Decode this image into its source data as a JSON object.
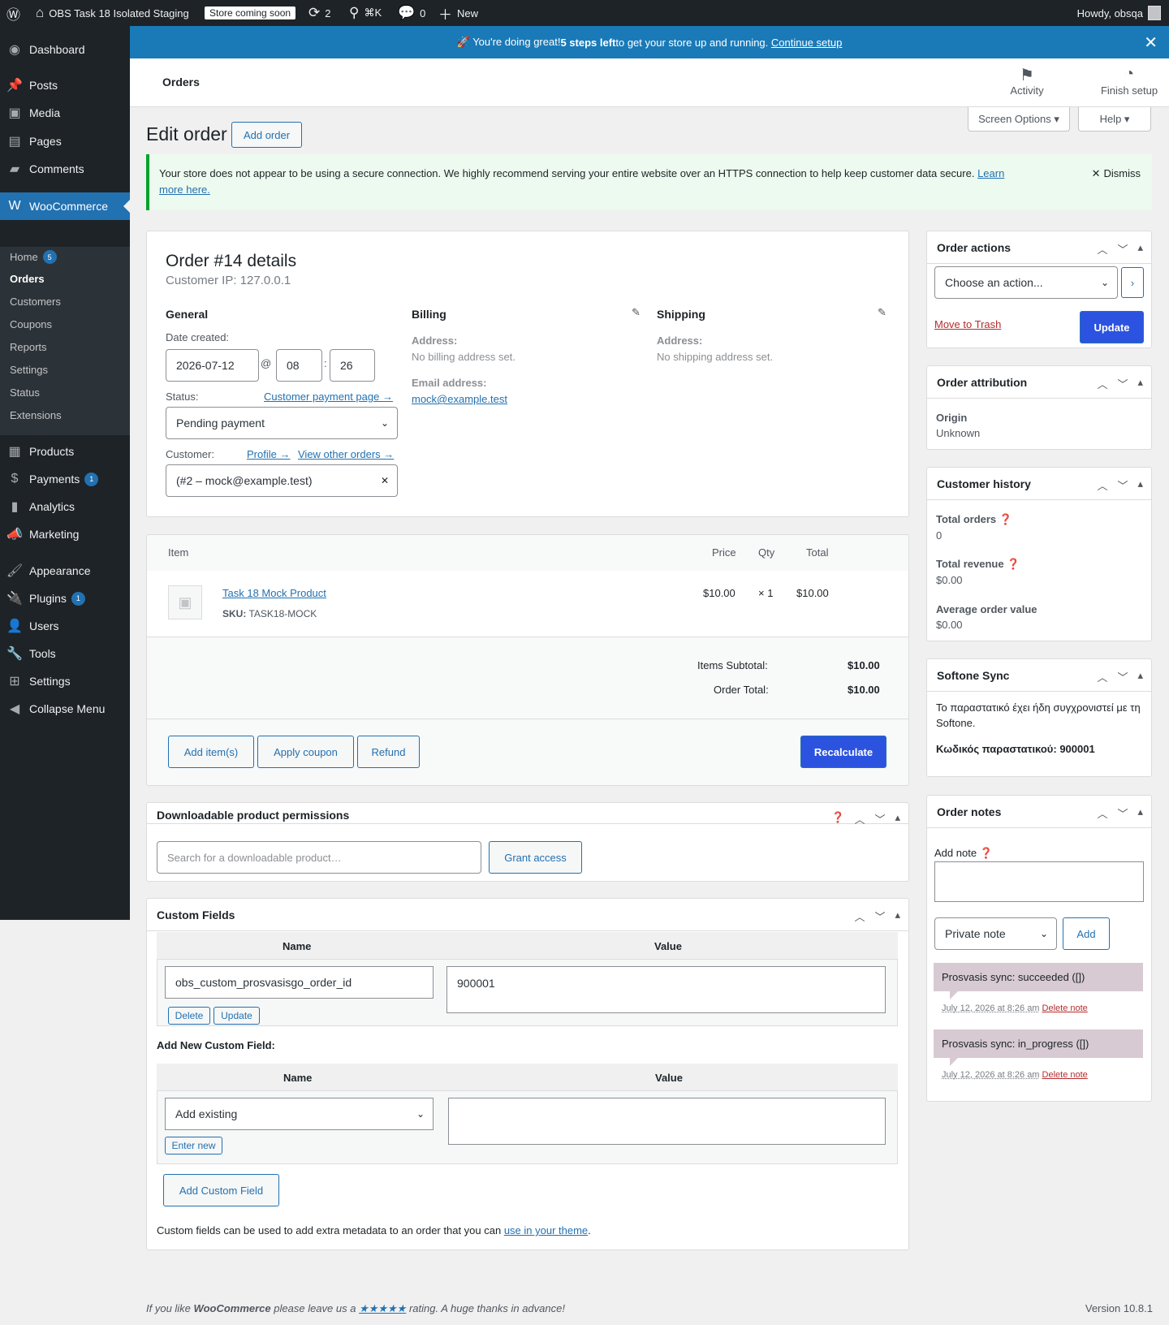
{
  "adminbar": {
    "site": "OBS Task 18 Isolated Staging",
    "store_badge": "Store coming soon",
    "updates": "2",
    "search_shortcut": "⌘K",
    "comments": "0",
    "new": "New",
    "howdy": "Howdy, obsqa"
  },
  "sidebar": {
    "dashboard": "Dashboard",
    "posts": "Posts",
    "media": "Media",
    "pages": "Pages",
    "comments": "Comments",
    "woocommerce": "WooCommerce",
    "sub": {
      "home": "Home",
      "home_count": "5",
      "orders": "Orders",
      "customers": "Customers",
      "coupons": "Coupons",
      "reports": "Reports",
      "settings": "Settings",
      "status": "Status",
      "extensions": "Extensions"
    },
    "products": "Products",
    "payments": "Payments",
    "payments_count": "1",
    "analytics": "Analytics",
    "marketing": "Marketing",
    "appearance": "Appearance",
    "plugins": "Plugins",
    "plugins_count": "1",
    "users": "Users",
    "tools": "Tools",
    "settings": "Settings",
    "collapse": "Collapse Menu"
  },
  "banner": {
    "prefix": "🚀 You're doing great! ",
    "bold": "5 steps left",
    "suffix": " to get your store up and running. ",
    "link": "Continue setup"
  },
  "header": {
    "title": "Orders",
    "activity": "Activity",
    "finish": "Finish setup"
  },
  "screen_options": "Screen Options ▾",
  "help": "Help ▾",
  "page": {
    "title": "Edit order",
    "add_order": "Add order"
  },
  "notice": {
    "text": "Your store does not appear to be using a secure connection. We highly recommend serving your entire website over an HTTPS connection to help keep customer data secure. ",
    "link": "Learn more here.",
    "dismiss": "Dismiss"
  },
  "order": {
    "title": "Order #14 details",
    "ip": "Customer IP: 127.0.0.1",
    "general": "General",
    "date_label": "Date created:",
    "date": "2026-07-12",
    "at": "@",
    "hour": "08",
    "colon": ":",
    "minute": "26",
    "status_label": "Status:",
    "payment_page": "Customer payment page →",
    "status": "Pending payment",
    "customer_label": "Customer:",
    "profile": "Profile →",
    "other_orders": "View other orders →",
    "customer": "(#2 – mock@example.test)",
    "billing": "Billing",
    "bill_addr_label": "Address:",
    "bill_addr": "No billing address set.",
    "email_label": "Email address:",
    "email": "mock@example.test",
    "shipping": "Shipping",
    "ship_addr_label": "Address:",
    "ship_addr": "No shipping address set."
  },
  "items": {
    "h_item": "Item",
    "h_price": "Price",
    "h_qty": "Qty",
    "h_total": "Total",
    "rows": [
      {
        "name": "Task 18 Mock Product",
        "sku_label": "SKU:",
        "sku": "TASK18-MOCK",
        "price": "$10.00",
        "qty": "× 1",
        "total": "$10.00"
      }
    ],
    "subtotal_label": "Items Subtotal:",
    "subtotal": "$10.00",
    "total_label": "Order Total:",
    "total": "$10.00",
    "add_items": "Add item(s)",
    "apply_coupon": "Apply coupon",
    "refund": "Refund",
    "recalculate": "Recalculate"
  },
  "downloads": {
    "title": "Downloadable product permissions",
    "placeholder": "Search for a downloadable product…",
    "grant": "Grant access"
  },
  "custom": {
    "title": "Custom Fields",
    "h_name": "Name",
    "h_value": "Value",
    "key": "obs_custom_prosvasisgo_order_id",
    "value": "900001",
    "delete": "Delete",
    "update": "Update",
    "add_new": "Add New Custom Field:",
    "add_existing": "Add existing",
    "enter_new": "Enter new",
    "add_btn": "Add Custom Field",
    "help_prefix": "Custom fields can be used to add extra metadata to an order that you can ",
    "help_link": "use in your theme",
    "help_suffix": "."
  },
  "actions": {
    "title": "Order actions",
    "choose": "Choose an action...",
    "trash": "Move to Trash",
    "update": "Update"
  },
  "attribution": {
    "title": "Order attribution",
    "origin_label": "Origin",
    "origin": "Unknown"
  },
  "history": {
    "title": "Customer history",
    "orders_label": "Total orders",
    "orders": "0",
    "revenue_label": "Total revenue",
    "revenue": "$0.00",
    "avg_label": "Average order value",
    "avg": "$0.00"
  },
  "softone": {
    "title": "Softone Sync",
    "text": "Το παραστατικό έχει ήδη συγχρονιστεί με τη Softone.",
    "code": "Κωδικός παραστατικού: 900001"
  },
  "notes": {
    "title": "Order notes",
    "add_label": "Add note",
    "type": "Private note",
    "add": "Add",
    "list": [
      {
        "text": "Prosvasis sync: succeeded ([])",
        "date": "July 12, 2026 at 8:26 am",
        "del": "Delete note"
      },
      {
        "text": "Prosvasis sync: in_progress ([])",
        "date": "July 12, 2026 at 8:26 am",
        "del": "Delete note"
      }
    ]
  },
  "footer": {
    "pre": "If you like ",
    "brand": "WooCommerce",
    "mid": " please leave us a ",
    "stars": "★★★★★",
    "post": " rating. A huge thanks in advance!",
    "version": "Version 10.8.1"
  }
}
